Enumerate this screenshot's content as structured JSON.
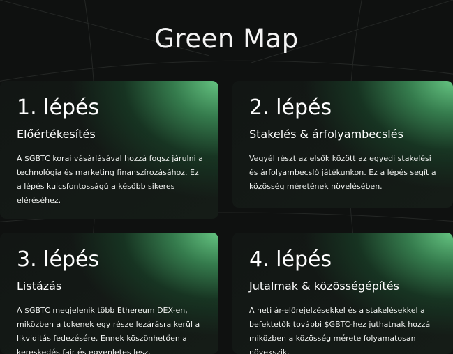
{
  "page": {
    "title": "Green Map"
  },
  "steps": [
    {
      "title": "1. lépés",
      "subtitle": "Előértékesítés",
      "description": "A $GBTC korai vásárlásával hozzá fogsz járulni a technológia és marketing finanszírozásához. Ez a lépés kulcsfontosságú a később sikeres eléréséhez."
    },
    {
      "title": "2. lépés",
      "subtitle": "Stakelés & árfolyambecslés",
      "description": "Vegyél részt az elsők között az egyedi stakelési és árfolyambecslő játékunkon. Ez a lépés segít a közösség méretének növelésében."
    },
    {
      "title": "3. lépés",
      "subtitle": "Listázás",
      "description": "A $GBTC megjelenik több Ethereum DEX-en, miközben a tokenek egy része lezárásra kerül a likviditás fedezésére. Ennek köszönhetően a kereskedés fair és egyenletes lesz."
    },
    {
      "title": "4. lépés",
      "subtitle": "Jutalmak & közösségépítés",
      "description": "A heti ár-előrejelzésekkel és a stakelésekkel a befektetők további $GBTC-hez juthatnak hozzá miközben a közösség mérete folyamatosan növekszik."
    }
  ],
  "colors": {
    "background": "#0f1110",
    "accent_green": "#4fb874",
    "text": "#ffffff"
  }
}
